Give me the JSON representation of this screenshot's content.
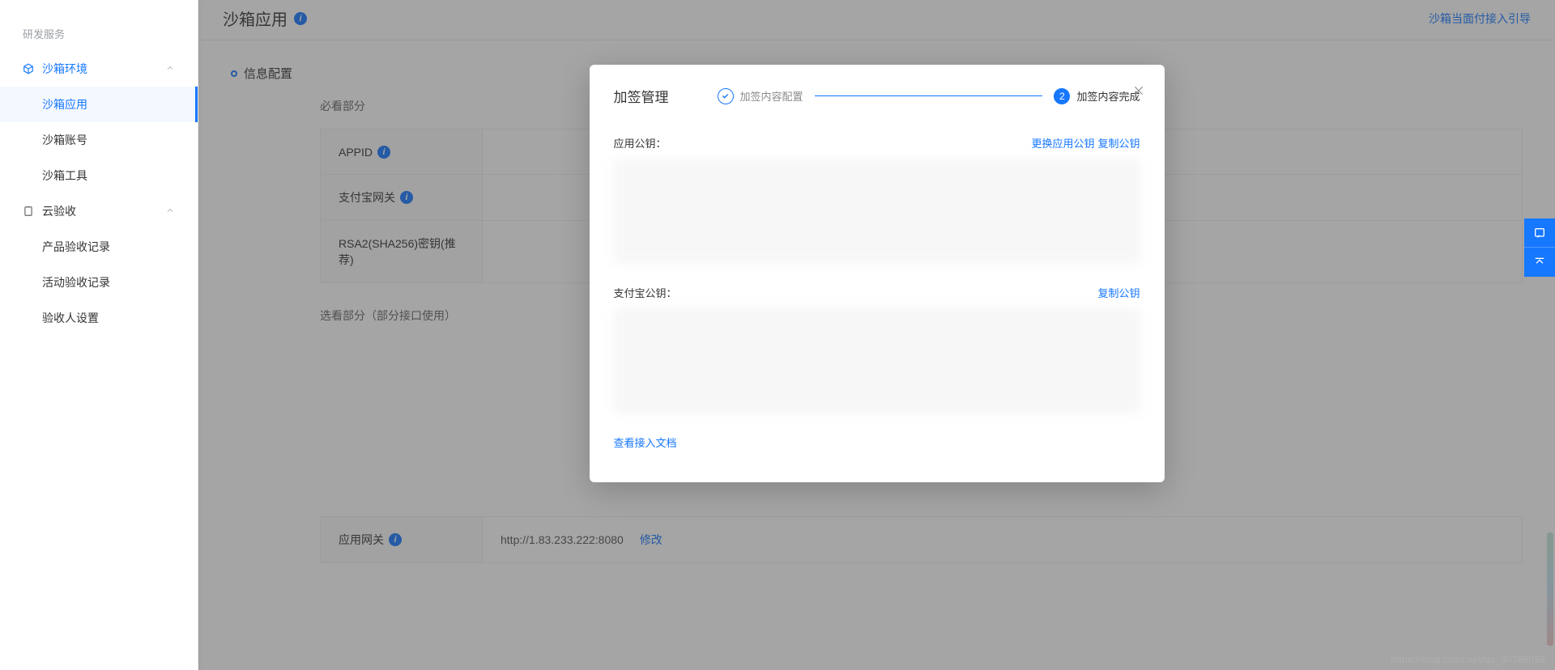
{
  "sidebar": {
    "section": "研发服务",
    "groups": [
      {
        "label": "沙箱环境",
        "expanded": true,
        "active": true,
        "items": [
          {
            "label": "沙箱应用",
            "active": true
          },
          {
            "label": "沙箱账号",
            "active": false
          },
          {
            "label": "沙箱工具",
            "active": false
          }
        ]
      },
      {
        "label": "云验收",
        "expanded": true,
        "active": false,
        "items": [
          {
            "label": "产品验收记录",
            "active": false
          },
          {
            "label": "活动验收记录",
            "active": false
          },
          {
            "label": "验收人设置",
            "active": false
          }
        ]
      }
    ]
  },
  "header": {
    "title": "沙箱应用",
    "guide_link": "沙箱当面付接入引导"
  },
  "page": {
    "section_title": "信息配置",
    "must_label": "必看部分",
    "optional_label": "选看部分（部分接口使用）",
    "rows": {
      "appid": "APPID",
      "gateway": "支付宝网关",
      "rsa2": "RSA2(SHA256)密钥(推荐)"
    },
    "app_gateway": {
      "label": "应用网关",
      "value": "http://1.83.233.222:8080",
      "action": "修改"
    }
  },
  "modal": {
    "title": "加签管理",
    "steps": {
      "s1": "加签内容配置",
      "s2": "加签内容完成",
      "s2_num": "2"
    },
    "app_key": {
      "label": "应用公钥：",
      "replace": "更换应用公钥",
      "copy": "复制公钥"
    },
    "alipay_key": {
      "label": "支付宝公钥：",
      "copy": "复制公钥"
    },
    "doc_link": "查看接入文档"
  },
  "watermark": "https://blog.csdn.net/qq_30385099"
}
